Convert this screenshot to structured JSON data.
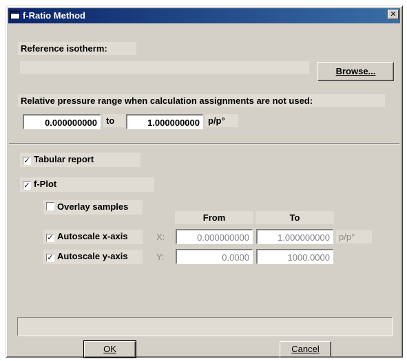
{
  "window": {
    "title": "f-Ratio Method",
    "close_glyph": "✕"
  },
  "reference": {
    "label": "Reference isotherm:",
    "path_value": "",
    "browse_label": "Browse..."
  },
  "pressure_range": {
    "label": "Relative pressure range when calculation assignments are not used:",
    "from_value": "0.000000000",
    "to_label": "to",
    "to_value": "1.000000000",
    "unit": "p/p°"
  },
  "options": {
    "tabular_report": {
      "label": "Tabular report",
      "checked": true
    },
    "f_plot": {
      "label": "f-Plot",
      "checked": true
    },
    "overlay_samples": {
      "label": "Overlay samples",
      "checked": false
    },
    "autoscale_x": {
      "label": "Autoscale x-axis",
      "checked": true
    },
    "autoscale_y": {
      "label": "Autoscale y-axis",
      "checked": true
    }
  },
  "axis_table": {
    "from_header": "From",
    "to_header": "To",
    "x_label": "X:",
    "x_from": "0.000000000",
    "x_to": "1.000000000",
    "x_unit": "p/p°",
    "y_label": "Y:",
    "y_from": "0.0000",
    "y_to": "1000.0000"
  },
  "status": {
    "text": ""
  },
  "buttons": {
    "ok_label": "OK",
    "cancel_label": "Cancel"
  }
}
